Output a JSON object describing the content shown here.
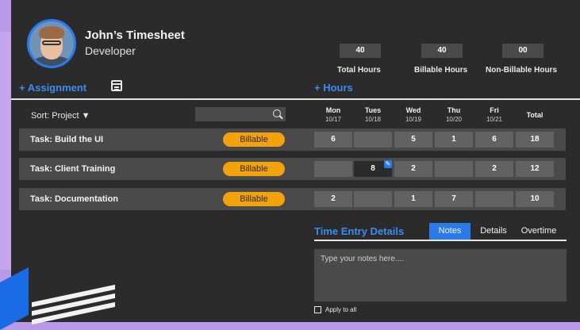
{
  "user": {
    "name": "John’s Timesheet",
    "role": "Developer"
  },
  "stats": [
    {
      "value": "40",
      "label": "Total Hours"
    },
    {
      "value": "40",
      "label": "Billable Hours"
    },
    {
      "value": "00",
      "label": "Non-Billable Hours"
    }
  ],
  "actions": {
    "add_assignment": "+ Assignment",
    "add_hours": "+ Hours"
  },
  "grid": {
    "sort_label": "Sort: Project ▼",
    "search_value": "",
    "days": [
      {
        "name": "Mon",
        "date": "10/17"
      },
      {
        "name": "Tues",
        "date": "10/18"
      },
      {
        "name": "Wed",
        "date": "10/19"
      },
      {
        "name": "Thu",
        "date": "10/20"
      },
      {
        "name": "Fri",
        "date": "10/21"
      }
    ],
    "total_label": "Total",
    "rows": [
      {
        "task": "Task: Build the UI",
        "type": "Billable",
        "hours": [
          "6",
          "",
          "5",
          "1",
          "6"
        ],
        "total": "18"
      },
      {
        "task": "Task: Client Training",
        "type": "Billable",
        "hours": [
          "",
          "8",
          "2",
          "",
          "2"
        ],
        "total": "12"
      },
      {
        "task": "Task: Documentation",
        "type": "Billable",
        "hours": [
          "2",
          "",
          "1",
          "7",
          ""
        ],
        "total": "10"
      }
    ]
  },
  "details": {
    "title": "Time Entry Details",
    "tabs": [
      "Notes",
      "Details",
      "Overtime"
    ],
    "active_tab": "Notes",
    "notes_placeholder": "Type your notes here....",
    "apply_label": "Apply to all"
  },
  "colors": {
    "accent": "#2a7be8",
    "billable": "#f4a20c",
    "panel": "#2b2b2b",
    "backdrop": "#b99ae6"
  }
}
